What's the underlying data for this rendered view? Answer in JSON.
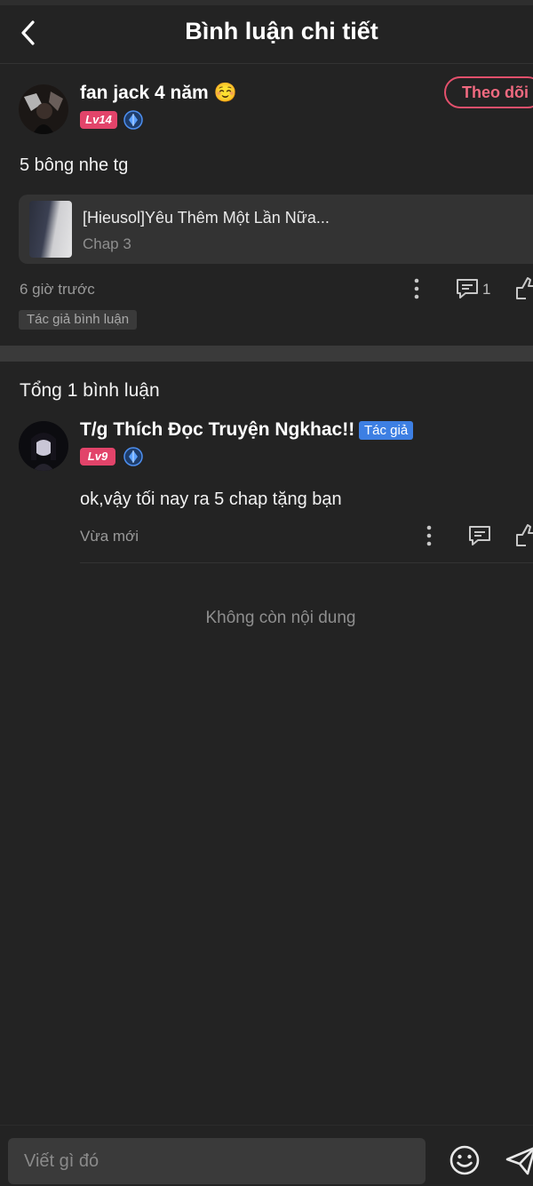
{
  "header": {
    "title": "Bình luận chi tiết"
  },
  "comment": {
    "username": "fan jack 4 năm ☺️",
    "level": "Lv14",
    "follow_label": "Theo dõi",
    "text": "5 bông nhe tg",
    "book": {
      "title": "[Hieusol]Yêu Thêm Một Lần Nữa...",
      "chapter": "Chap 3"
    },
    "time": "6 giờ trước",
    "reply_count": "1",
    "tag": "Tác giả bình luận"
  },
  "replies_section": {
    "total_label": "Tổng 1 bình luận",
    "replies": [
      {
        "username": "T/g Thích Đọc Truyện Ngkhac!!",
        "badge": "Tác giả",
        "level": "Lv9",
        "text": "ok,vậy tối nay ra 5 chap tặng bạn",
        "time": "Vừa mới"
      }
    ],
    "end_label": "Không còn nội dung"
  },
  "input": {
    "placeholder": "Viết gì đó"
  },
  "colors": {
    "background": "#232323",
    "accent": "#e3506c",
    "author_badge": "#3d7fe3",
    "level_badge": "#e2446a"
  },
  "icons": [
    "back-icon",
    "vip-diamond-icon",
    "more-icon",
    "comment-icon",
    "like-icon",
    "emoji-icon",
    "send-icon"
  ]
}
